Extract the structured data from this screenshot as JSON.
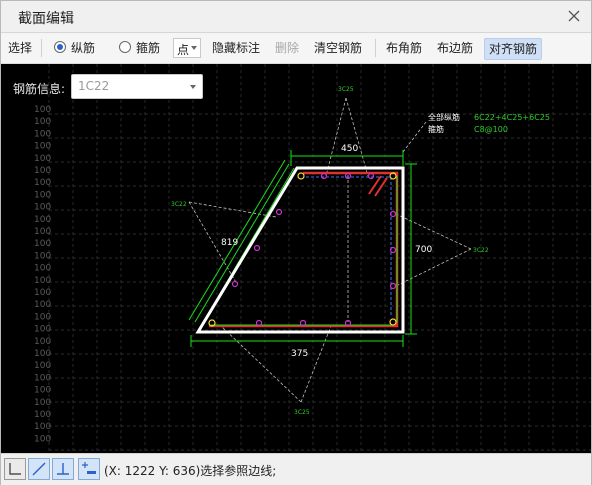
{
  "window": {
    "title": "截面编辑"
  },
  "toolbar": {
    "select": "选择",
    "longitudinal": "纵筋",
    "stirrup": "箍筋",
    "point_mode": "点",
    "hide_annotation": "隐藏标注",
    "delete": "删除",
    "clear_rebar": "清空钢筋",
    "corner_rebar": "布角筋",
    "edge_rebar": "布边筋",
    "align_rebar": "对齐钢筋"
  },
  "rebar_info": {
    "label": "钢筋信息:",
    "value": "1C22"
  },
  "drawing": {
    "grid_label": "100",
    "dim_top": "450",
    "dim_right": "700",
    "dim_bottom": "375",
    "dim_left": "819",
    "note_all_long_label": "全部纵筋",
    "note_all_long_value": "6C22+4C25+6C25",
    "note_stirrup_label": "箍筋",
    "note_stirrup_value": "C8@100",
    "leader_top": "3C25",
    "leader_left": "3C22",
    "leader_right": "3C22",
    "leader_bottom": "3C25"
  },
  "status": {
    "text": "(X: 1222 Y: 636)选择参照边线;"
  },
  "colors": {
    "rebar_point": "#cc33cc",
    "green_dim": "#19e019",
    "note": "#2ecc2e",
    "section_outline": "#ffffff",
    "stirrup": "#e03030"
  }
}
